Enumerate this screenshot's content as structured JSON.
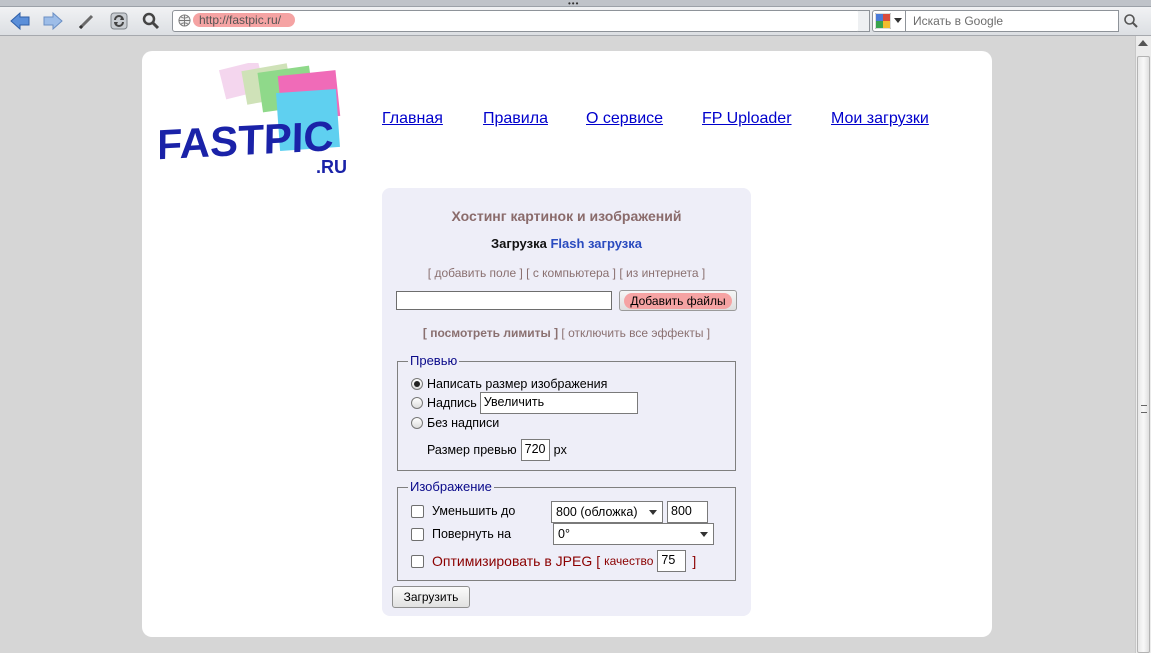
{
  "browser": {
    "url": "http://fastpic.ru/",
    "search_placeholder": "Искать в Google"
  },
  "logo": {
    "main": "FASTPIC",
    "suffix": ".RU"
  },
  "nav": [
    "Главная",
    "Правила",
    "О сервисе",
    "FP Uploader",
    "Мои загрузки"
  ],
  "panel": {
    "title": "Хостинг картинок и изображений",
    "mode_label": "Загрузка",
    "flash_link": "Flash загрузка",
    "links": [
      "[ добавить поле ]",
      "[ с компьютера ]",
      "[ из интернета ]"
    ],
    "add_files_button": "Добавить файлы",
    "limits_link": "[ посмотреть лимиты ]",
    "effects_link": "[ отключить все эффекты ]",
    "preview": {
      "legend": "Превью",
      "option_size": "Написать размер изображения",
      "option_caption": "Надпись",
      "caption_value": "Увеличить",
      "option_none": "Без надписи",
      "size_label": "Размер превью",
      "size_value": "720",
      "size_unit": "px"
    },
    "image": {
      "legend": "Изображение",
      "reduce_label": "Уменьшить до",
      "reduce_select": "800 (обложка)",
      "reduce_value": "800",
      "rotate_label": "Повернуть на",
      "rotate_select": "0°",
      "jpeg_label": "Оптимизировать в JPEG",
      "bracket_open": "[",
      "quality_label": "качество",
      "quality_value": "75",
      "bracket_close": "]"
    },
    "upload_button": "Загрузить"
  }
}
